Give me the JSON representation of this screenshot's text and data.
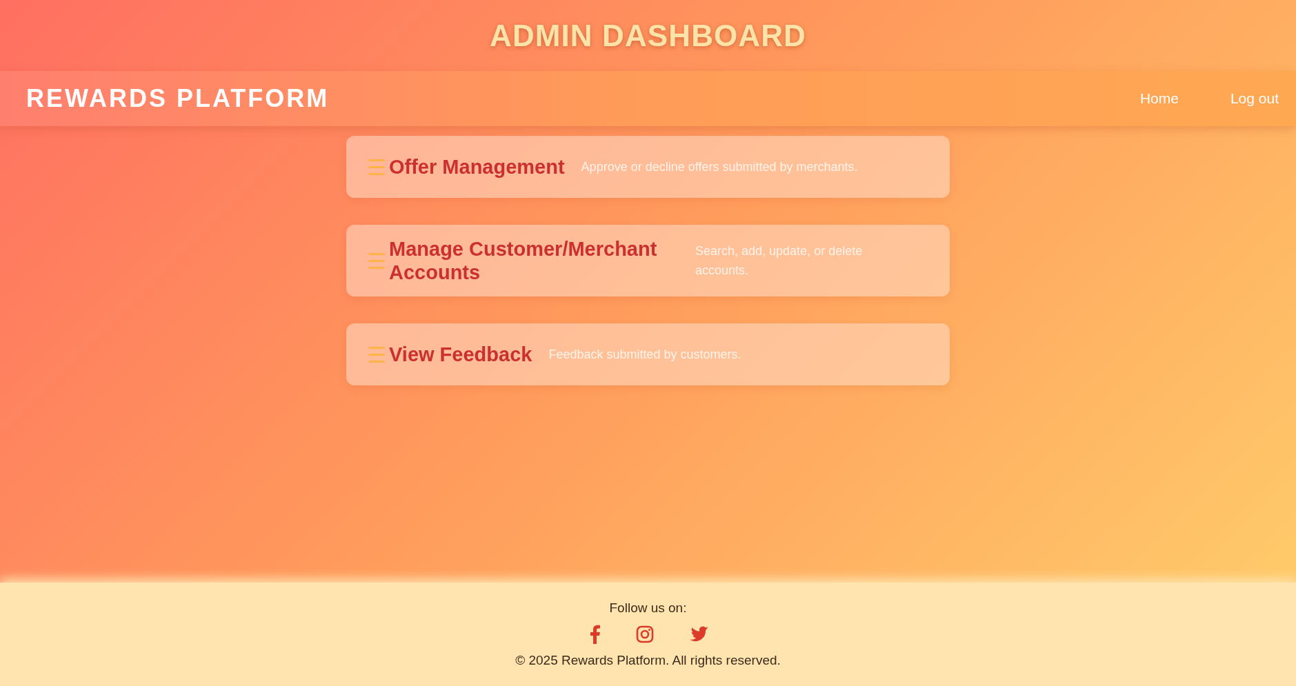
{
  "page_title": "ADMIN DASHBOARD",
  "navbar": {
    "brand": "REWARDS PLATFORM",
    "links": [
      "Home",
      "Log out"
    ]
  },
  "cards": [
    {
      "title": "Offer Management",
      "description": "Approve or decline offers submitted by merchants."
    },
    {
      "title": "Manage Customer/Merchant Accounts",
      "description": "Search, add, update, or delete accounts."
    },
    {
      "title": "View Feedback",
      "description": "Feedback submitted by customers."
    }
  ],
  "footer": {
    "follow_text": "Follow us on:",
    "copyright": "© 2025 Rewards Platform. All rights reserved."
  }
}
